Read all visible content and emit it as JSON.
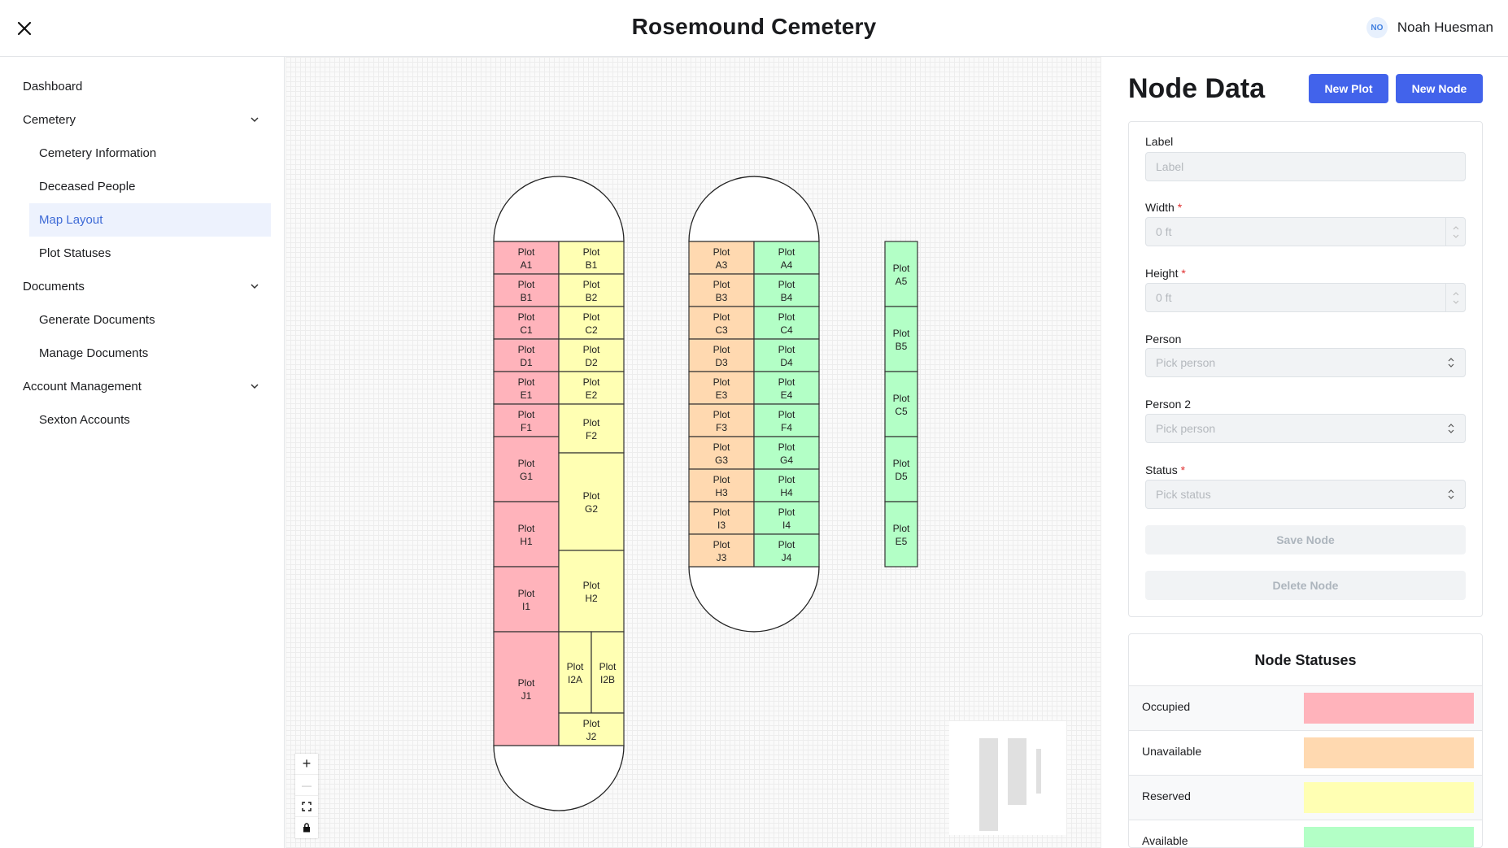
{
  "header": {
    "title": "Rosemound Cemetery",
    "user_initials": "NO",
    "user_name": "Noah Huesman"
  },
  "sidebar": {
    "items": [
      {
        "label": "Dashboard",
        "level": 0,
        "expandable": false,
        "active": false
      },
      {
        "label": "Cemetery",
        "level": 0,
        "expandable": true,
        "active": false
      },
      {
        "label": "Cemetery Information",
        "level": 1,
        "expandable": false,
        "active": false
      },
      {
        "label": "Deceased People",
        "level": 1,
        "expandable": false,
        "active": false
      },
      {
        "label": "Map Layout",
        "level": 1,
        "expandable": false,
        "active": true
      },
      {
        "label": "Plot Statuses",
        "level": 1,
        "expandable": false,
        "active": false
      },
      {
        "label": "Documents",
        "level": 0,
        "expandable": true,
        "active": false
      },
      {
        "label": "Generate Documents",
        "level": 1,
        "expandable": false,
        "active": false
      },
      {
        "label": "Manage Documents",
        "level": 1,
        "expandable": false,
        "active": false
      },
      {
        "label": "Account Management",
        "level": 0,
        "expandable": true,
        "active": false
      },
      {
        "label": "Sexton Accounts",
        "level": 1,
        "expandable": false,
        "active": false
      }
    ]
  },
  "colors": {
    "occupied": "#ffb3bb",
    "unavailable": "#ffd9b0",
    "reserved": "#ffffb3",
    "available": "#b3ffc6",
    "primary": "#4263eb",
    "active_nav_bg": "#edf2fd",
    "active_nav_text": "#3d6ad6"
  },
  "map": {
    "plots": [
      {
        "label": "Plot A1",
        "status": "occupied"
      },
      {
        "label": "Plot B1",
        "status": "occupied"
      },
      {
        "label": "Plot C1",
        "status": "occupied"
      },
      {
        "label": "Plot D1",
        "status": "occupied"
      },
      {
        "label": "Plot E1",
        "status": "occupied"
      },
      {
        "label": "Plot F1",
        "status": "occupied"
      },
      {
        "label": "Plot G1",
        "status": "occupied"
      },
      {
        "label": "Plot H1",
        "status": "occupied"
      },
      {
        "label": "Plot I1",
        "status": "occupied"
      },
      {
        "label": "Plot J1",
        "status": "occupied"
      },
      {
        "label": "Plot B1",
        "status": "reserved"
      },
      {
        "label": "Plot B2",
        "status": "reserved"
      },
      {
        "label": "Plot C2",
        "status": "reserved"
      },
      {
        "label": "Plot D2",
        "status": "reserved"
      },
      {
        "label": "Plot E2",
        "status": "reserved"
      },
      {
        "label": "Plot F2",
        "status": "reserved"
      },
      {
        "label": "Plot G2",
        "status": "reserved"
      },
      {
        "label": "Plot H2",
        "status": "reserved"
      },
      {
        "label": "Plot I2A",
        "status": "reserved"
      },
      {
        "label": "Plot I2B",
        "status": "reserved"
      },
      {
        "label": "Plot J2",
        "status": "reserved"
      },
      {
        "label": "Plot A3",
        "status": "unavailable"
      },
      {
        "label": "Plot B3",
        "status": "unavailable"
      },
      {
        "label": "Plot C3",
        "status": "unavailable"
      },
      {
        "label": "Plot D3",
        "status": "unavailable"
      },
      {
        "label": "Plot E3",
        "status": "unavailable"
      },
      {
        "label": "Plot F3",
        "status": "unavailable"
      },
      {
        "label": "Plot G3",
        "status": "unavailable"
      },
      {
        "label": "Plot H3",
        "status": "unavailable"
      },
      {
        "label": "Plot I3",
        "status": "unavailable"
      },
      {
        "label": "Plot J3",
        "status": "unavailable"
      },
      {
        "label": "Plot A4",
        "status": "available"
      },
      {
        "label": "Plot B4",
        "status": "available"
      },
      {
        "label": "Plot C4",
        "status": "available"
      },
      {
        "label": "Plot D4",
        "status": "available"
      },
      {
        "label": "Plot E4",
        "status": "available"
      },
      {
        "label": "Plot F4",
        "status": "available"
      },
      {
        "label": "Plot G4",
        "status": "available"
      },
      {
        "label": "Plot H4",
        "status": "available"
      },
      {
        "label": "Plot I4",
        "status": "available"
      },
      {
        "label": "Plot J4",
        "status": "available"
      },
      {
        "label": "Plot A5",
        "status": "available"
      },
      {
        "label": "Plot B5",
        "status": "available"
      },
      {
        "label": "Plot C5",
        "status": "available"
      },
      {
        "label": "Plot D5",
        "status": "available"
      },
      {
        "label": "Plot E5",
        "status": "available"
      }
    ]
  },
  "panel": {
    "title": "Node Data",
    "new_plot_label": "New Plot",
    "new_node_label": "New Node",
    "form": {
      "label_label": "Label",
      "label_placeholder": "Label",
      "width_label": "Width",
      "width_placeholder": "0 ft",
      "height_label": "Height",
      "height_placeholder": "0 ft",
      "person_label": "Person",
      "person_placeholder": "Pick person",
      "person2_label": "Person 2",
      "person2_placeholder": "Pick person",
      "status_label": "Status",
      "status_placeholder": "Pick status",
      "required_mark": "*",
      "save_label": "Save Node",
      "delete_label": "Delete Node"
    },
    "statuses": {
      "title": "Node Statuses",
      "items": [
        {
          "name": "Occupied",
          "color": "#ffb3bb"
        },
        {
          "name": "Unavailable",
          "color": "#ffd9b0"
        },
        {
          "name": "Reserved",
          "color": "#ffffb3"
        },
        {
          "name": "Available",
          "color": "#b3ffc6"
        }
      ]
    }
  },
  "zoom": {
    "in": "+",
    "out": "—"
  }
}
